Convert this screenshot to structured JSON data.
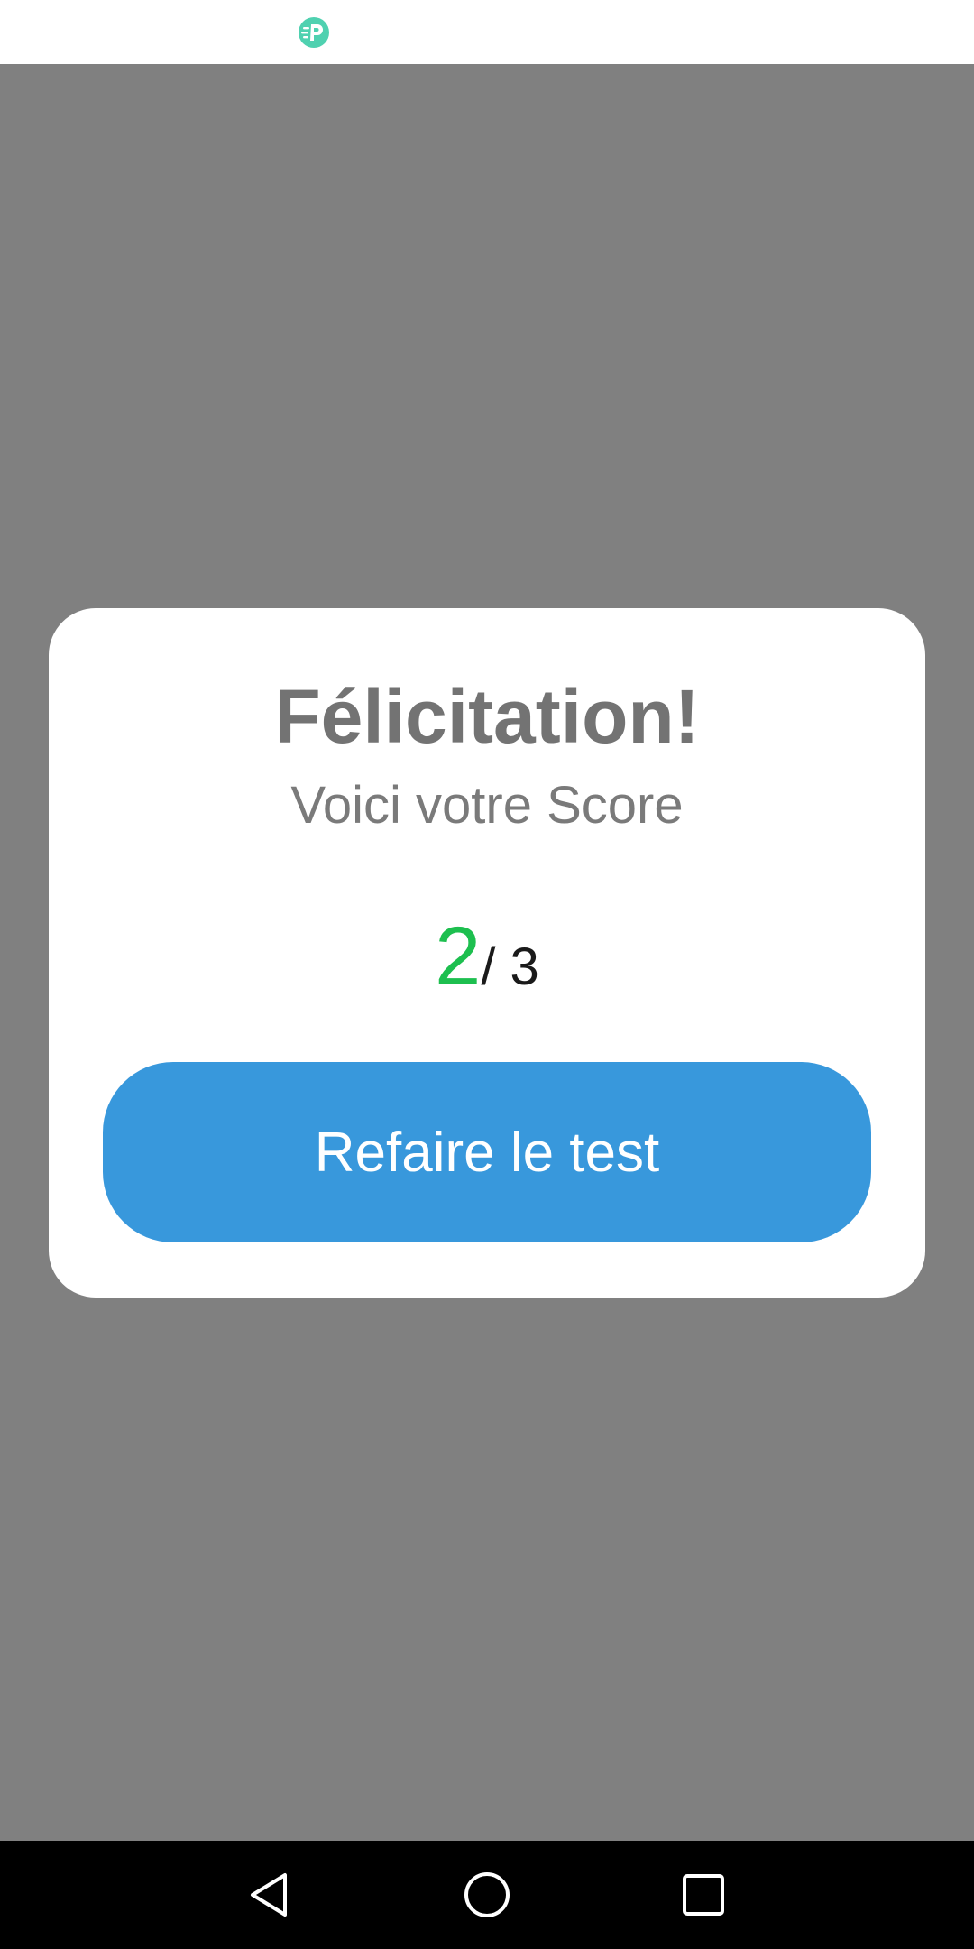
{
  "status_bar": {
    "app_icon": "app-notification-icon",
    "icon_color": "#4fd1b0"
  },
  "dialog": {
    "title": "Félicitation!",
    "subtitle": "Voici votre Score",
    "score": {
      "value": "2",
      "total": "/ 3",
      "value_color": "#1dbf4f"
    },
    "button_label": "Refaire le test",
    "button_color": "#3898dc"
  },
  "nav_bar": {
    "back_icon": "back-icon",
    "home_icon": "home-icon",
    "recents_icon": "recents-icon"
  }
}
